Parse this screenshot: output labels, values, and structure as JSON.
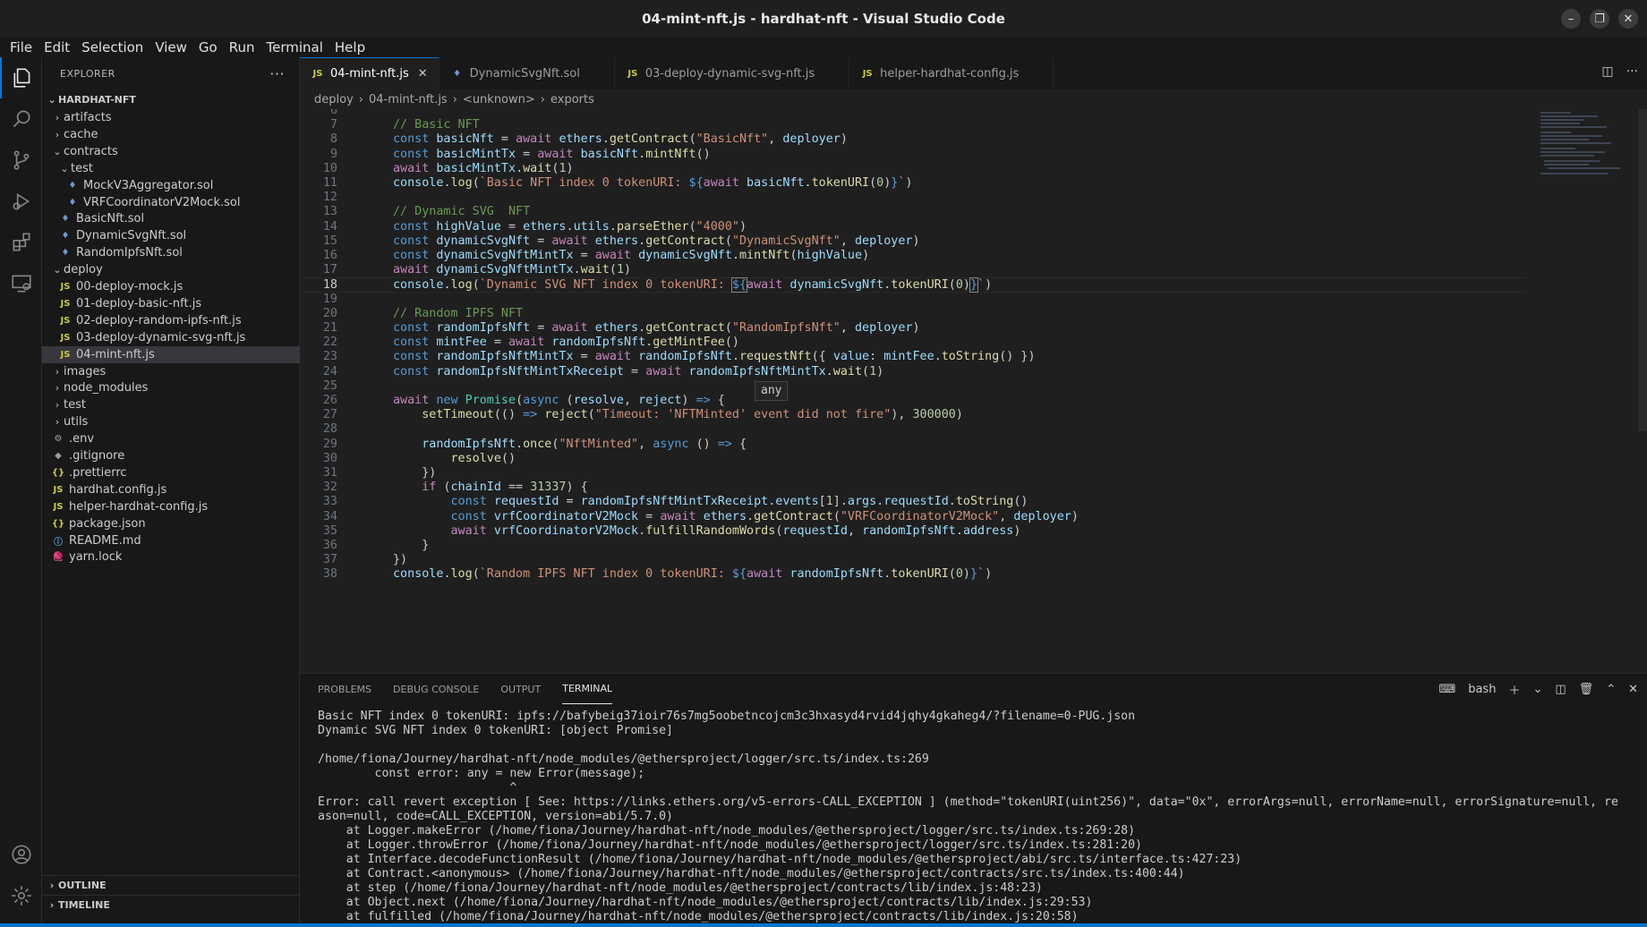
{
  "window": {
    "title": "04-mint-nft.js - hardhat-nft - Visual Studio Code"
  },
  "menu": [
    "File",
    "Edit",
    "Selection",
    "View",
    "Go",
    "Run",
    "Terminal",
    "Help"
  ],
  "explorer": {
    "header": "EXPLORER",
    "root": "HARDHAT-NFT",
    "items": [
      {
        "label": "artifacts",
        "type": "folder",
        "depth": 1,
        "open": false
      },
      {
        "label": "cache",
        "type": "folder",
        "depth": 1,
        "open": false
      },
      {
        "label": "contracts",
        "type": "folder",
        "depth": 1,
        "open": true
      },
      {
        "label": "test",
        "type": "folder",
        "depth": 2,
        "open": true
      },
      {
        "label": "MockV3Aggregator.sol",
        "type": "sol",
        "depth": 3
      },
      {
        "label": "VRFCoordinatorV2Mock.sol",
        "type": "sol",
        "depth": 3
      },
      {
        "label": "BasicNft.sol",
        "type": "sol",
        "depth": 2
      },
      {
        "label": "DynamicSvgNft.sol",
        "type": "sol",
        "depth": 2
      },
      {
        "label": "RandomIpfsNft.sol",
        "type": "sol",
        "depth": 2
      },
      {
        "label": "deploy",
        "type": "folder",
        "depth": 1,
        "open": true
      },
      {
        "label": "00-deploy-mock.js",
        "type": "js",
        "depth": 2
      },
      {
        "label": "01-deploy-basic-nft.js",
        "type": "js",
        "depth": 2
      },
      {
        "label": "02-deploy-random-ipfs-nft.js",
        "type": "js",
        "depth": 2
      },
      {
        "label": "03-deploy-dynamic-svg-nft.js",
        "type": "js",
        "depth": 2
      },
      {
        "label": "04-mint-nft.js",
        "type": "js",
        "depth": 2,
        "selected": true
      },
      {
        "label": "images",
        "type": "folder",
        "depth": 1,
        "open": false
      },
      {
        "label": "node_modules",
        "type": "folder",
        "depth": 1,
        "open": false
      },
      {
        "label": "test",
        "type": "folder",
        "depth": 1,
        "open": false
      },
      {
        "label": "utils",
        "type": "folder",
        "depth": 1,
        "open": false
      },
      {
        "label": ".env",
        "type": "gear",
        "depth": 1
      },
      {
        "label": ".gitignore",
        "type": "dot",
        "depth": 1
      },
      {
        "label": ".prettierrc",
        "type": "brace",
        "depth": 1
      },
      {
        "label": "hardhat.config.js",
        "type": "js",
        "depth": 1
      },
      {
        "label": "helper-hardhat-config.js",
        "type": "js",
        "depth": 1
      },
      {
        "label": "package.json",
        "type": "brace",
        "depth": 1
      },
      {
        "label": "README.md",
        "type": "info",
        "depth": 1
      },
      {
        "label": "yarn.lock",
        "type": "yarn",
        "depth": 1
      }
    ],
    "outline": "OUTLINE",
    "timeline": "TIMELINE"
  },
  "tabs": [
    {
      "label": "04-mint-nft.js",
      "type": "js",
      "active": true
    },
    {
      "label": "DynamicSvgNft.sol",
      "type": "sol"
    },
    {
      "label": "03-deploy-dynamic-svg-nft.js",
      "type": "js"
    },
    {
      "label": "helper-hardhat-config.js",
      "type": "js"
    }
  ],
  "breadcrumb": [
    "deploy",
    "04-mint-nft.js",
    "<unknown>",
    "exports"
  ],
  "code": {
    "current_line": 18,
    "hover_text": "any",
    "lines": [
      {
        "n": 6,
        "html": ""
      },
      {
        "n": 7,
        "html": "<span class='com'>// Basic NFT</span>"
      },
      {
        "n": 8,
        "html": "<span class='kw'>const</span> <span class='var'>basicNft</span> = <span class='kw2'>await</span> <span class='var'>ethers</span>.<span class='fn'>getContract</span>(<span class='str'>\"BasicNft\"</span>, <span class='var'>deployer</span>)"
      },
      {
        "n": 9,
        "html": "<span class='kw'>const</span> <span class='var'>basicMintTx</span> = <span class='kw2'>await</span> <span class='var'>basicNft</span>.<span class='fn'>mintNft</span>()"
      },
      {
        "n": 10,
        "html": "<span class='kw2'>await</span> <span class='var'>basicMintTx</span>.<span class='fn'>wait</span>(<span class='num'>1</span>)"
      },
      {
        "n": 11,
        "html": "<span class='var'>console</span>.<span class='fn'>log</span>(<span class='str'>`Basic NFT index 0 tokenURI: </span><span class='tpl'>${</span><span class='kw2'>await</span> <span class='var'>basicNft</span>.<span class='fn'>tokenURI</span>(<span class='num'>0</span>)<span class='tpl'>}</span><span class='str'>`</span>)"
      },
      {
        "n": 12,
        "html": ""
      },
      {
        "n": 13,
        "html": "<span class='com'>// Dynamic SVG  NFT</span>"
      },
      {
        "n": 14,
        "html": "<span class='kw'>const</span> <span class='var'>highValue</span> = <span class='var'>ethers</span>.<span class='var'>utils</span>.<span class='fn'>parseEther</span>(<span class='str'>\"4000\"</span>)"
      },
      {
        "n": 15,
        "html": "<span class='kw'>const</span> <span class='var'>dynamicSvgNft</span> = <span class='kw2'>await</span> <span class='var'>ethers</span>.<span class='fn'>getContract</span>(<span class='str'>\"DynamicSvgNft\"</span>, <span class='var'>deployer</span>)"
      },
      {
        "n": 16,
        "html": "<span class='kw'>const</span> <span class='var'>dynamicSvgNftMintTx</span> = <span class='kw2'>await</span> <span class='var'>dynamicSvgNft</span>.<span class='fn'>mintNft</span>(<span class='var'>highValue</span>)"
      },
      {
        "n": 17,
        "html": "<span class='kw2'>await</span> <span class='var'>dynamicSvgNftMintTx</span>.<span class='fn'>wait</span>(<span class='num'>1</span>)"
      },
      {
        "n": 18,
        "html": "<span class='var'>console</span>.<span class='fn'>log</span>(<span class='str'>`Dynamic SVG NFT index 0 tokenURI: </span><span class='tpl' style='outline:1px solid #888'>${</span><span class='kw2'>await</span> <span class='var'>dynamicSvgNft</span>.<span class='fn'>tokenURI</span>(<span class='num'>0</span>)<span class='tpl' style='outline:1px solid #888'>}</span><span class='str'>`</span>)"
      },
      {
        "n": 19,
        "html": ""
      },
      {
        "n": 20,
        "html": "<span class='com'>// Random IPFS NFT</span>"
      },
      {
        "n": 21,
        "html": "<span class='kw'>const</span> <span class='var'>randomIpfsNft</span> = <span class='kw2'>await</span> <span class='var'>ethers</span>.<span class='fn'>getContract</span>(<span class='str'>\"RandomIpfsNft\"</span>, <span class='var'>deployer</span>)"
      },
      {
        "n": 22,
        "html": "<span class='kw'>const</span> <span class='var'>mintFee</span> = <span class='kw2'>await</span> <span class='var'>randomIpfsNft</span>.<span class='fn'>getMintFee</span>()"
      },
      {
        "n": 23,
        "html": "<span class='kw'>const</span> <span class='var'>randomIpfsNftMintTx</span> = <span class='kw2'>await</span> <span class='var'>randomIpfsNft</span>.<span class='fn'>requestNft</span>({ <span class='var'>value</span>: <span class='var'>mintFee</span>.<span class='fn'>toString</span>() })"
      },
      {
        "n": 24,
        "html": "<span class='kw'>const</span> <span class='var'>randomIpfsNftMintTxReceipt</span> = <span class='kw2'>await</span> <span class='var'>randomIpfsNftMintTx</span>.<span class='fn'>wait</span>(<span class='num'>1</span>)"
      },
      {
        "n": 25,
        "html": ""
      },
      {
        "n": 26,
        "html": "<span class='kw2'>await</span> <span class='kw'>new</span> <span class='obj'>Promise</span>(<span class='kw'>async</span> (<span class='var'>resolve</span>, <span class='var'>reject</span>) <span class='kw'>=&gt;</span> {"
      },
      {
        "n": 27,
        "html": "    <span class='fn'>setTimeout</span>(() <span class='kw'>=&gt;</span> <span class='fn'>reject</span>(<span class='str'>\"Timeout: 'NFTMinted' event did not fire\"</span>), <span class='num'>300000</span>)"
      },
      {
        "n": 28,
        "html": ""
      },
      {
        "n": 29,
        "html": "    <span class='var'>randomIpfsNft</span>.<span class='fn'>once</span>(<span class='str'>\"NftMinted\"</span>, <span class='kw'>async</span> () <span class='kw'>=&gt;</span> {"
      },
      {
        "n": 30,
        "html": "        <span class='fn'>resolve</span>()"
      },
      {
        "n": 31,
        "html": "    })"
      },
      {
        "n": 32,
        "html": "    <span class='kw2'>if</span> (<span class='var'>chainId</span> == <span class='num'>31337</span>) {"
      },
      {
        "n": 33,
        "html": "        <span class='kw'>const</span> <span class='var'>requestId</span> = <span class='var'>randomIpfsNftMintTxReceipt</span>.<span class='var'>events</span>[<span class='num'>1</span>].<span class='var'>args</span>.<span class='var'>requestId</span>.<span class='fn'>toString</span>()"
      },
      {
        "n": 34,
        "html": "        <span class='kw'>const</span> <span class='var'>vrfCoordinatorV2Mock</span> = <span class='kw2'>await</span> <span class='var'>ethers</span>.<span class='fn'>getContract</span>(<span class='str'>\"VRFCoordinatorV2Mock\"</span>, <span class='var'>deployer</span>)"
      },
      {
        "n": 35,
        "html": "        <span class='kw2'>await</span> <span class='var'>vrfCoordinatorV2Mock</span>.<span class='fn'>fulfillRandomWords</span>(<span class='var'>requestId</span>, <span class='var'>randomIpfsNft</span>.<span class='var'>address</span>)"
      },
      {
        "n": 36,
        "html": "    }"
      },
      {
        "n": 37,
        "html": "})"
      },
      {
        "n": 38,
        "html": "<span class='var'>console</span>.<span class='fn'>log</span>(<span class='str'>`Random IPFS NFT index 0 tokenURI: </span><span class='tpl'>${</span><span class='kw2'>await</span> <span class='var'>randomIpfsNft</span>.<span class='fn'>tokenURI</span>(<span class='num'>0</span>)<span class='tpl'>}</span><span class='str'>`</span>)"
      }
    ]
  },
  "panel": {
    "tabs": [
      "PROBLEMS",
      "DEBUG CONSOLE",
      "OUTPUT",
      "TERMINAL"
    ],
    "active_tab": "TERMINAL",
    "shell": "bash",
    "terminal_lines": [
      "Basic NFT index 0 tokenURI: ipfs://bafybeig37ioir76s7mg5oobetncojcm3c3hxasyd4rvid4jqhy4gkaheg4/?filename=0-PUG.json",
      "Dynamic SVG NFT index 0 tokenURI: [object Promise]",
      "",
      "/home/fiona/Journey/hardhat-nft/node_modules/@ethersproject/logger/src.ts/index.ts:269",
      "        const error: any = new Error(message);",
      "                           ^",
      "Error: call revert exception [ See: https://links.ethers.org/v5-errors-CALL_EXCEPTION ] (method=\"tokenURI(uint256)\", data=\"0x\", errorArgs=null, errorName=null, errorSignature=null, re",
      "ason=null, code=CALL_EXCEPTION, version=abi/5.7.0)",
      "    at Logger.makeError (/home/fiona/Journey/hardhat-nft/node_modules/@ethersproject/logger/src.ts/index.ts:269:28)",
      "    at Logger.throwError (/home/fiona/Journey/hardhat-nft/node_modules/@ethersproject/logger/src.ts/index.ts:281:20)",
      "    at Interface.decodeFunctionResult (/home/fiona/Journey/hardhat-nft/node_modules/@ethersproject/abi/src.ts/interface.ts:427:23)",
      "    at Contract.<anonymous> (/home/fiona/Journey/hardhat-nft/node_modules/@ethersproject/contracts/src.ts/index.ts:400:44)",
      "    at step (/home/fiona/Journey/hardhat-nft/node_modules/@ethersproject/contracts/lib/index.js:48:23)",
      "    at Object.next (/home/fiona/Journey/hardhat-nft/node_modules/@ethersproject/contracts/lib/index.js:29:53)",
      "    at fulfilled (/home/fiona/Journey/hardhat-nft/node_modules/@ethersproject/contracts/lib/index.js:20:58)"
    ]
  },
  "colors": {
    "accent": "#0078d4",
    "bg": "#1e1e1e",
    "sidebar": "#181818"
  }
}
